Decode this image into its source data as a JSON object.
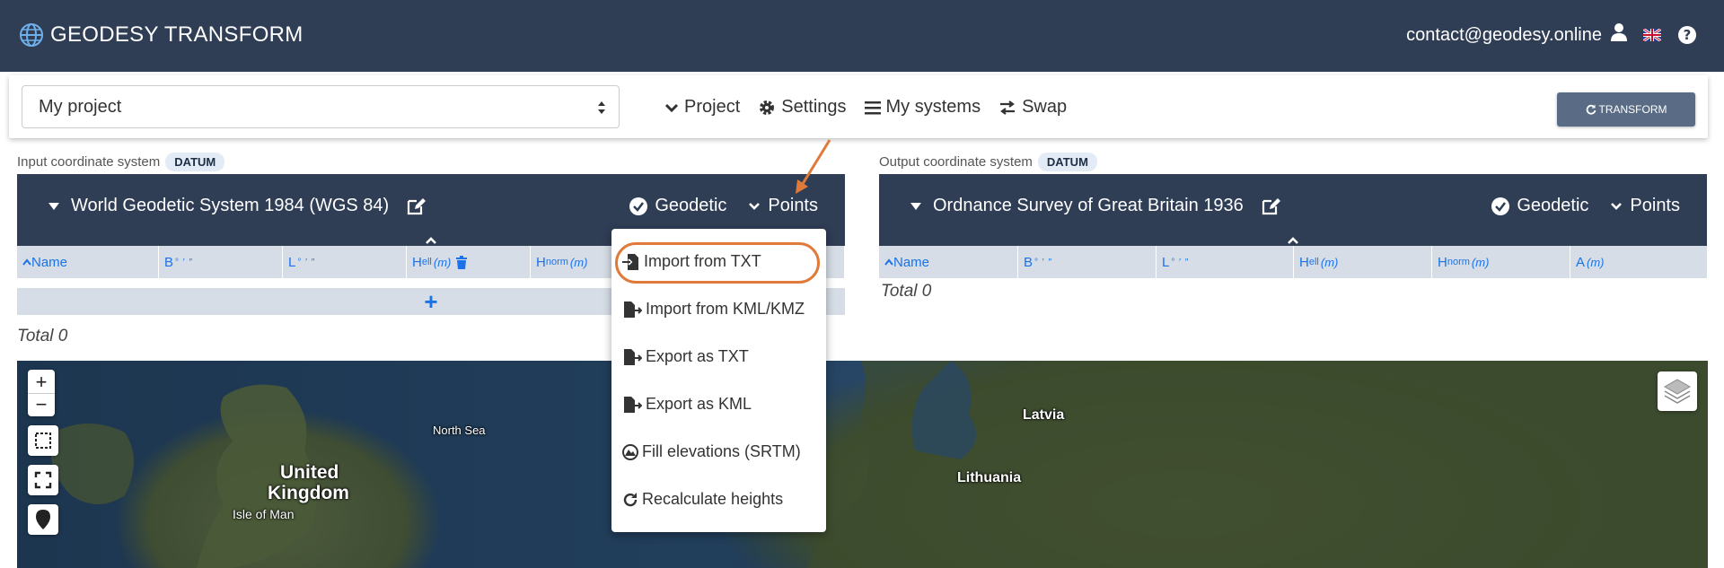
{
  "app": {
    "title": "GEODESY TRANSFORM",
    "email": "contact@geodesy.online"
  },
  "toolbar": {
    "project_value": "My project",
    "menu": [
      "Project",
      "Settings",
      "My systems",
      "Swap"
    ],
    "transform_label": "TRANSFORM"
  },
  "input": {
    "label": "Input coordinate system",
    "badge": "DATUM",
    "system": "World Geodetic System 1984 (WGS 84)",
    "mode": "Geodetic",
    "points_label": "Points",
    "columns": {
      "name": "Name",
      "b": "B",
      "l": "L",
      "hell_main": "H",
      "hell_sub": "ell",
      "unit": "(m)",
      "hnorm_main": "H",
      "hnorm_sub": "norm"
    },
    "total": "Total 0"
  },
  "output": {
    "label": "Output coordinate system",
    "badge": "DATUM",
    "system": "Ordnance Survey of Great Britain 1936",
    "mode": "Geodetic",
    "points_label": "Points",
    "columns": {
      "name": "Name",
      "b": "B",
      "l": "L",
      "hell_main": "H",
      "hell_sub": "ell",
      "unit": "(m)",
      "hnorm_main": "H",
      "hnorm_sub": "norm",
      "a": "A"
    },
    "total": "Total 0"
  },
  "dropdown": {
    "items": [
      "Import from TXT",
      "Import from KML/KMZ",
      "Export as TXT",
      "Export as KML",
      "Fill elevations (SRTM)",
      "Recalculate heights"
    ]
  },
  "map": {
    "labels": [
      "North Sea",
      "United",
      "Kingdom",
      "Isle of Man",
      "Latvia",
      "Lithuania"
    ],
    "zoom_in": "+",
    "zoom_out": "−"
  },
  "colors": {
    "header": "#2f3d55",
    "accent": "#1a73e8",
    "highlight": "#e07a3b"
  }
}
